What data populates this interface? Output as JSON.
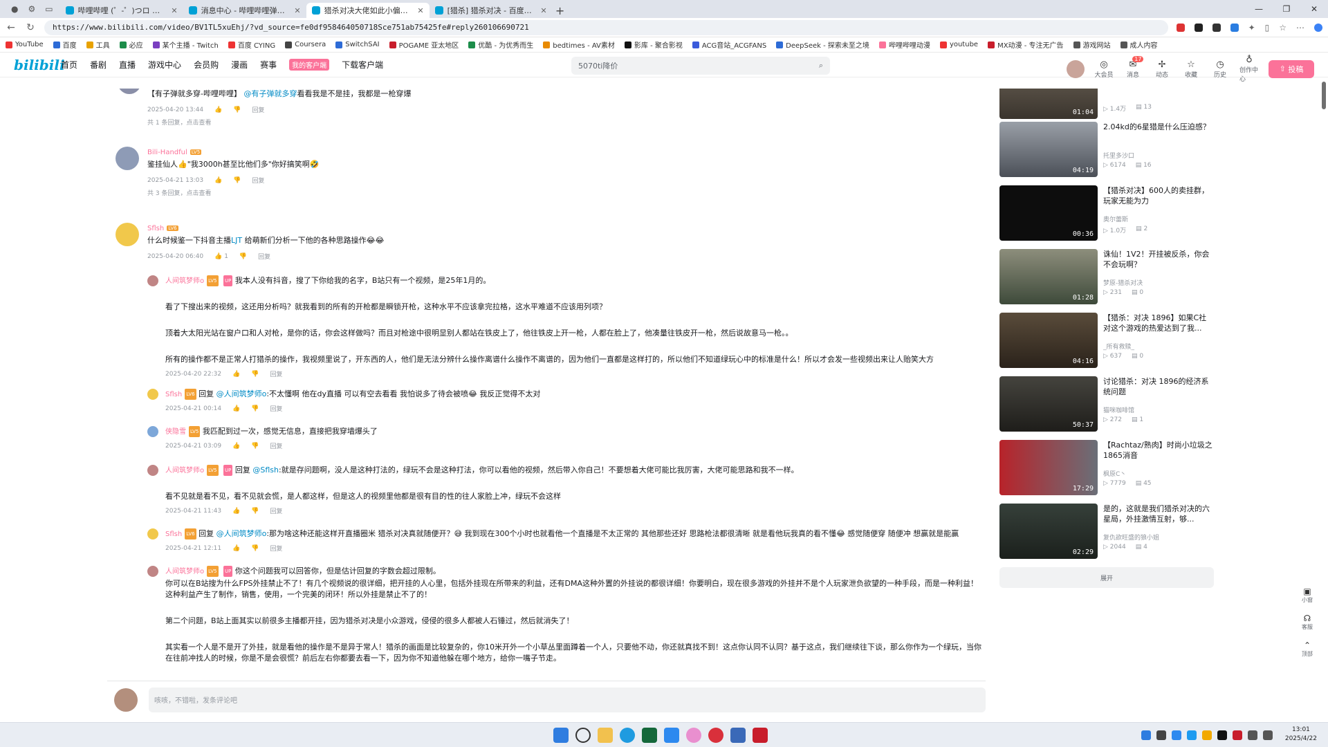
{
  "browser": {
    "tabs": [
      {
        "title": "哔哩哔哩 (゜-゜)つロ 干杯~-bilibili"
      },
      {
        "title": "消息中心 - 哔哩哔哩弹幕视频网"
      },
      {
        "title": "猎杀对决大佬如此小偏移视频"
      },
      {
        "title": "[猎杀] 猎杀对决 - 百度贴吧"
      }
    ],
    "url": "https://www.bilibili.com/video/BV1TL5xuEhj/?vd_source=fe0df958464050718Sce751ab75425fe#reply260106690721",
    "bookmarks": [
      "YouTube",
      "百度",
      "工具",
      "必应",
      "某个主播 - Twitch",
      "百度 CYING",
      "Coursera",
      "SwitchSAI",
      "POGAME 亚太地区",
      "优酷 - 为优秀而生",
      "bedtimes - AV素材",
      "影库 - 聚合影视",
      "ACG音站_ACGFANS",
      "DeepSeek - 探索未至之境",
      "哔哩哔哩动漫",
      "youtube",
      "MX动漫 - 专注无广告",
      "游戏网站",
      "成人内容"
    ]
  },
  "header": {
    "logo": "bilibili",
    "nav": [
      "首页",
      "番剧",
      "直播",
      "游戏中心",
      "会员购",
      "漫画",
      "赛事",
      "我的客户端",
      "下载客户端"
    ],
    "nav_highlight": "我的客户端",
    "search_text": "5070ti降价",
    "icons": [
      {
        "label": "大会员",
        "icon": "vip-icon"
      },
      {
        "label": "消息",
        "icon": "message-icon",
        "badge": "17"
      },
      {
        "label": "动态",
        "icon": "dynamic-icon"
      },
      {
        "label": "收藏",
        "icon": "favorite-icon"
      },
      {
        "label": "历史",
        "icon": "history-icon"
      },
      {
        "label": "创作中心",
        "icon": "creator-icon"
      }
    ],
    "upload_label": "投稿"
  },
  "comments": [
    {
      "text_top": "【有子弹就多穿-哔哩哔哩】",
      "mention": "@有子弹就多穿",
      "rest": "看看我是不是挂，我都是一枪穿爆",
      "time": "2025-04-20 13:44",
      "reply": "回复",
      "sub": "共 1 条回复，点击查看"
    },
    {
      "user": "Bili-Handful",
      "text": "鉴挂仙人👍\"我3000h甚至比他们多\"你好搞笑啊🤣",
      "time": "2025-04-21 13:03",
      "reply": "回复",
      "sub": "共 3 条回复，点击查看"
    },
    {
      "user": "Sflsh",
      "text_a": "什么时候鉴一下抖音主播",
      "link": "LJT",
      "text_b": " 给萌新们分析一下他的各种思路操作😂😂",
      "time": "2025-04-20 06:40",
      "likes": "1",
      "reply": "回复"
    }
  ],
  "replies": [
    {
      "user": "人间筑梦师o",
      "up": "UP",
      "lines": [
        "我本人没有抖音，搜了下你给我的名字，B站只有一个视频，是25年1月的。",
        "看了下搜出来的视频，这还用分析吗？就我看到的所有的开枪都是瞬锁开枪，这种水平不应该拿完拉格，这水平难道不应该用列项？",
        "顶着大太阳光站在窗户口和人对枪，是你的话，你会这样做吗？而且对枪途中很明显别人都站在铁皮上了，他往铁皮上开一枪，人都在脸上了，他凑量往铁皮开一枪，然后说故意马一枪。。",
        "所有的操作都不是正常人打猎杀的操作，我视频里说了，开东西的人，他们是无法分辨什么操作离谱什么操作不离谱的，因为他们一直都是这样打的，所以他们不知道绿玩心中的标准是什么！所以才会发一些视频出来让人贻笑大方"
      ],
      "time": "2025-04-20 22:32",
      "reply": "回复"
    },
    {
      "user": "Sflsh",
      "pre": "回复",
      "mention": "@人间筑梦师o",
      "text": ":不太懂啊 他在dy直播 可以有空去看看 我怕说多了待会被喷😂 我反正觉得不太对",
      "time": "2025-04-21 00:14",
      "reply": "回复"
    },
    {
      "user": "侠隐雪",
      "text": "我匹配到过一次，感觉无信息，直接把我穿墙爆头了",
      "time": "2025-04-21 03:09",
      "reply": "回复"
    },
    {
      "user": "人间筑梦师o",
      "up": "UP",
      "pre": "回复",
      "mention": "@Sflsh",
      "text": ":就是存问题啊，没人是这种打法的，绿玩不会是这种打法，你可以看他的视频，然后带入你自己！不要想着大佬可能比我厉害，大佬可能思路和我不一样。",
      "line2": "看不见就是看不见，看不见就会慌，是人都这样，但是这人的视频里他都是很有目的性的往人家脸上冲，绿玩不会这样",
      "time": "2025-04-21 11:43",
      "reply": "回复"
    },
    {
      "user": "Sflsh",
      "pre": "回复",
      "mention": "@人间筑梦师o",
      "text": ":那为啥这种还能这样开直播圈米 猎杀对决真就随便开？😅 我到现在300个小时也就看他一个直播是不太正常的 其他那些还好 思路枪法都很清晰 就是看他玩我真的看不懂😂 感觉随便穿 随便冲 想赢就是能赢",
      "time": "2025-04-21 12:11",
      "reply": "回复"
    },
    {
      "user": "人间筑梦师o",
      "up": "UP",
      "lines": [
        "你这个问题我可以回答你，但是估计回复的字数会超过限制。",
        "你可以在B站搜为什么FPS外挂禁止不了！有几个视频说的很详细，把开挂的人心里，包括外挂现在所带来的利益，还有DMA这种外置的外挂说的都很详细！你要明白，现在很多游戏的外挂并不是个人玩家泄负欲望的一种手段，而是一种利益！这种利益产生了制作，销售，使用，一个完美的闭环！所以外挂是禁止不了的！",
        "第二个问题，B站上面其实以前很多主播都开挂，因为猎杀对决是小众游戏，侵侵的很多人都被人石锤过，然后就消失了！",
        "其实看一个人是不是开了外挂，就是看他的操作是不是异于常人！猎杀的画面是比较复杂的，你10米开外一个小草丛里面蹲着一个人，只要他不动，你还就真找不到！这点你认同不认同？基于这点，我们继续往下谈，那么你作为一个绿玩，当你在往前冲找人的时候，你是不是会很慌？前后左右你都要去看一下，因为你不知道他躲在哪个地方，给你一嘴子节走。"
      ]
    }
  ],
  "comment_input_placeholder": "咳咳，不错啦，发条评论吧",
  "recommend": [
    {
      "title": "",
      "up": "",
      "views": "1.4万",
      "comments": "13",
      "dur": "01:04"
    },
    {
      "title": "2.04kd的6星猎是什么压迫感？",
      "up": "托里多沙口",
      "views": "6174",
      "comments": "16",
      "dur": "04:19"
    },
    {
      "title": "【猎杀对决】600人的卖挂群，玩家无能为力",
      "up": "奥尔蕾斯",
      "views": "1.0万",
      "comments": "2",
      "dur": "00:36"
    },
    {
      "title": "诛仙！1V2！开挂被反杀，你会不会玩啊？",
      "up": "梦原-猎杀对决",
      "views": "231",
      "comments": "0",
      "dur": "01:28"
    },
    {
      "title": "【猎杀：对决 1896】如果C社对这个游戏的热爱达到了我...",
      "up": "_所有救赎_",
      "views": "637",
      "comments": "0",
      "dur": "04:16"
    },
    {
      "title": "讨论猎杀：对决 1896的经济系统问题",
      "up": "猫咪咖啡馆",
      "views": "272",
      "comments": "1",
      "dur": "50:37"
    },
    {
      "title": "【Rachtaz/熟肉】时尚小垃圾之1865消音",
      "up": "枫原C丶",
      "views": "7779",
      "comments": "45",
      "dur": "17:29"
    },
    {
      "title": "是的，这就是我们猎杀对决的六星局，外挂激情互射，够...",
      "up": "复仇欲旺盛的狼小姐",
      "views": "2044",
      "comments": "4",
      "dur": "02:29"
    }
  ],
  "expand_label": "展开",
  "side_buttons": [
    "小窗",
    "客服",
    "顶部"
  ],
  "taskbar": {
    "time": "13:01",
    "date": "2025/4/22"
  }
}
